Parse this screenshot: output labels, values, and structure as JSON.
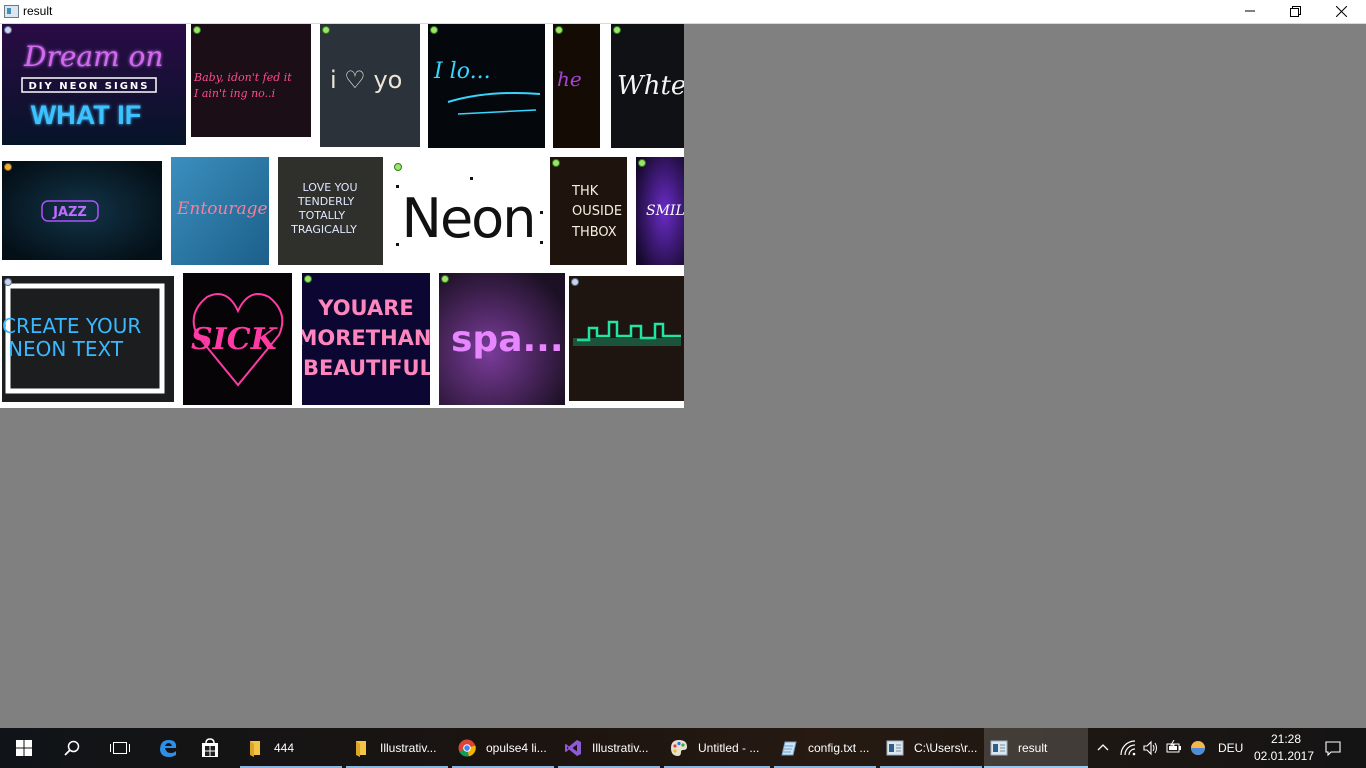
{
  "window": {
    "title": "result",
    "controls": {
      "minimize_icon": "minimize-icon",
      "maximize_icon": "restore-icon",
      "close_icon": "close-icon"
    }
  },
  "mosaic": {
    "tiles": [
      {
        "id": "dream-on",
        "lines": [
          "Dream on",
          "DIY NEON SIGNS",
          "WHAT IF"
        ],
        "colors": [
          "#c04ce0",
          "#ffffff",
          "#39b8ff"
        ]
      },
      {
        "id": "baby",
        "lines": [
          "Baby, idon't fed it",
          "I ain't ing no..i"
        ],
        "colors": [
          "#ff3f8e"
        ]
      },
      {
        "id": "i-love-you",
        "lines": [
          "i ♡ yo"
        ],
        "colors": [
          "#e8e2d6"
        ]
      },
      {
        "id": "i-love",
        "lines": [
          "I lo..."
        ],
        "colors": [
          "#30d0ff"
        ]
      },
      {
        "id": "hello",
        "lines": [
          "he"
        ],
        "colors": [
          "#a040d0"
        ]
      },
      {
        "id": "white",
        "lines": [
          "Whte"
        ],
        "colors": [
          "#f0f0f0"
        ]
      },
      {
        "id": "jazz",
        "lines": [
          "JAZZ"
        ],
        "colors": [
          "#b04cff"
        ]
      },
      {
        "id": "entourage",
        "lines": [
          "Entourage"
        ],
        "colors": [
          "#ff6e8a"
        ]
      },
      {
        "id": "love-you-tenderly",
        "lines": [
          "LOVE YOU",
          "TENDERLY",
          "TOTALLY",
          "TRAGICALLY"
        ],
        "colors": [
          "#d8e6ff"
        ]
      },
      {
        "id": "neon-logo",
        "lines": [
          "Neon"
        ],
        "colors": [
          "#111111"
        ]
      },
      {
        "id": "think-outside",
        "lines": [
          "THK",
          "OUSIDE",
          "THBOX"
        ],
        "colors": [
          "#f2eedd"
        ]
      },
      {
        "id": "smile",
        "lines": [
          "SMILE"
        ],
        "colors": [
          "#ffffff"
        ]
      },
      {
        "id": "create-neon",
        "lines": [
          "CREATE YOUR",
          "NEON TEXT"
        ],
        "colors": [
          "#36b8ff"
        ]
      },
      {
        "id": "sick",
        "lines": [
          "SICK"
        ],
        "colors": [
          "#ff3fa0"
        ]
      },
      {
        "id": "beautiful",
        "lines": [
          "YOUARE",
          "MORETHAN",
          "BEAUTIFUL"
        ],
        "colors": [
          "#ff80b8"
        ]
      },
      {
        "id": "space",
        "lines": [
          "spa..."
        ],
        "colors": [
          "#e070ff"
        ]
      },
      {
        "id": "skyline",
        "lines": [],
        "colors": [
          "#20e0a0"
        ]
      }
    ]
  },
  "taskbar": {
    "start_icon": "windows-logo-icon",
    "search_icon": "search-icon",
    "task_view_icon": "task-view-icon",
    "pinned": [
      {
        "name": "edge",
        "icon": "edge-icon"
      },
      {
        "name": "store",
        "icon": "store-icon"
      }
    ],
    "tasks": [
      {
        "label": "444",
        "icon": "folder-icon",
        "running": true
      },
      {
        "label": "Illustrativ...",
        "icon": "folder-icon",
        "running": true
      },
      {
        "label": "opulse4 li...",
        "icon": "chrome-icon",
        "running": true
      },
      {
        "label": "Illustrativ...",
        "icon": "visual-studio-icon",
        "running": true
      },
      {
        "label": "Untitled - ...",
        "icon": "paint-icon",
        "running": true
      },
      {
        "label": "config.txt ...",
        "icon": "notepad-icon",
        "running": true
      },
      {
        "label": "C:\\Users\\r...",
        "icon": "console-icon",
        "running": true
      },
      {
        "label": "result",
        "icon": "app-window-icon",
        "running": true,
        "active": true
      }
    ],
    "tray": {
      "chevron_icon": "chevron-up-icon",
      "network_icon": "wifi-icon",
      "volume_icon": "volume-icon",
      "battery_icon": "battery-icon",
      "app_tray_icon": "tray-app-icon",
      "language": "DEU",
      "time": "21:28",
      "date": "02.01.2017",
      "notifications_icon": "action-center-icon"
    }
  }
}
